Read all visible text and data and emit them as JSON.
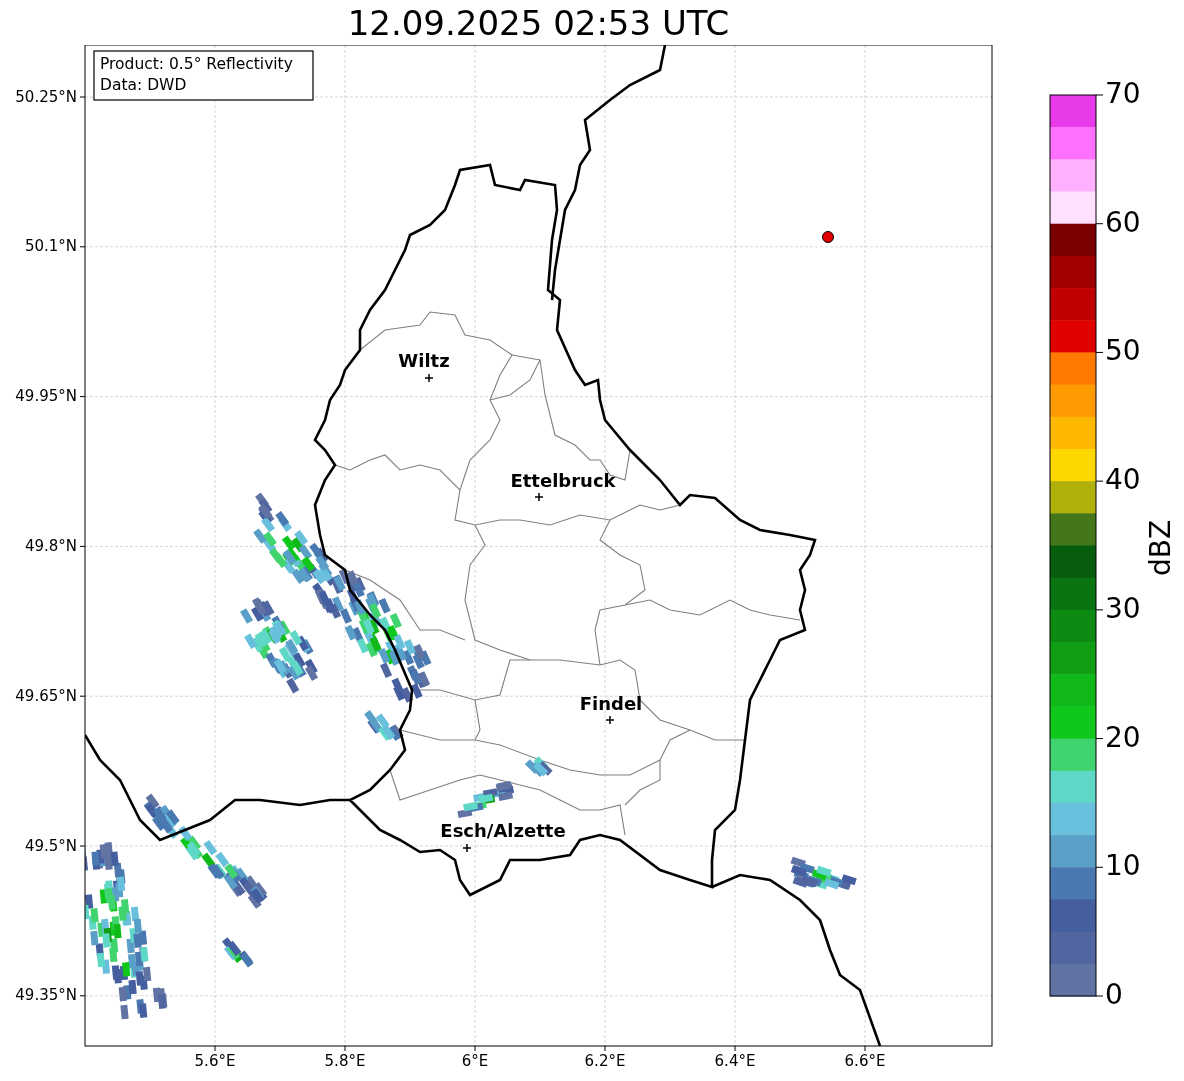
{
  "title": "12.09.2025 02:53 UTC",
  "legend": [
    "Product: 0.5° Reflectivity",
    "Data: DWD"
  ],
  "x_ticks": [
    "5.6°E",
    "5.8°E",
    "6°E",
    "6.2°E",
    "6.4°E",
    "6.6°E"
  ],
  "y_ticks": [
    "50.25°N",
    "50.1°N",
    "49.95°N",
    "49.8°N",
    "49.65°N",
    "49.5°N",
    "49.35°N"
  ],
  "cities": [
    {
      "name": "Wiltz"
    },
    {
      "name": "Ettelbruck"
    },
    {
      "name": "Findel"
    },
    {
      "name": "Esch/Alzette"
    }
  ],
  "colorbar": {
    "label": "dBZ",
    "ticks": [
      "70",
      "60",
      "50",
      "40",
      "30",
      "20",
      "10",
      "0"
    ],
    "segments": [
      {
        "color": "#e83ae8"
      },
      {
        "color": "#ff70ff"
      },
      {
        "color": "#ffb0ff"
      },
      {
        "color": "#ffe0ff"
      },
      {
        "color": "#7a0000"
      },
      {
        "color": "#a00000"
      },
      {
        "color": "#c00000"
      },
      {
        "color": "#e00000"
      },
      {
        "color": "#ff7a00"
      },
      {
        "color": "#ff9a00"
      },
      {
        "color": "#ffb800"
      },
      {
        "color": "#ffd700"
      },
      {
        "color": "#b0b00a"
      },
      {
        "color": "#45761a"
      },
      {
        "color": "#065e0c"
      },
      {
        "color": "#0a7410"
      },
      {
        "color": "#0d8a12"
      },
      {
        "color": "#109f14"
      },
      {
        "color": "#10b818"
      },
      {
        "color": "#10c81c"
      },
      {
        "color": "#3fd46e"
      },
      {
        "color": "#5fd8c8"
      },
      {
        "color": "#68c0dc"
      },
      {
        "color": "#5a9fc8"
      },
      {
        "color": "#4a78b0"
      },
      {
        "color": "#445ea0"
      },
      {
        "color": "#5166a0"
      },
      {
        "color": "#6173a3"
      }
    ]
  }
}
